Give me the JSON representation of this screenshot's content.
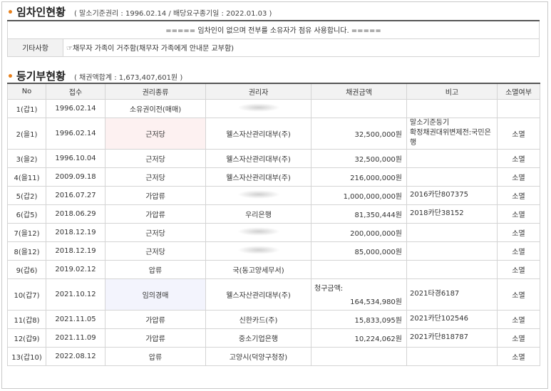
{
  "tenant_section": {
    "title": "임차인현황",
    "subtitle": "( 말소기준권리 : 1996.02.14 / 배당요구종기일 : 2022.01.03 )",
    "notice": "===== 임차인이 없으며 전부를 소유자가 점유 사용합니다. =====",
    "etc_label": "기타사항",
    "etc_value": "☞채무자 가족이 거주함(채무자 가족에게 안내문 교부함)"
  },
  "registry_section": {
    "title": "등기부현황",
    "subtitle": "( 채권액합계 : 1,673,407,601원 )",
    "headers": [
      "No",
      "접수",
      "권리종류",
      "권리자",
      "채권금액",
      "비고",
      "소멸여부"
    ],
    "rows": [
      {
        "no": "1(갑1)",
        "date": "1996.02.14",
        "type": "소유권이전(매매)",
        "holder": "",
        "holder_hidden": true,
        "amount": "",
        "memo": "",
        "status": ""
      },
      {
        "no": "2(을1)",
        "date": "1996.02.14",
        "type": "근저당",
        "holder": "웰스자산관리대부(주)",
        "amount": "32,500,000원",
        "memo": "말소기준등기\n확정채권대위변제전:국민은행",
        "status": "소멸"
      },
      {
        "no": "3(을2)",
        "date": "1996.10.04",
        "type": "근저당",
        "holder": "웰스자산관리대부(주)",
        "amount": "32,500,000원",
        "memo": "",
        "status": "소멸"
      },
      {
        "no": "4(을11)",
        "date": "2009.09.18",
        "type": "근저당",
        "holder": "웰스자산관리대부(주)",
        "amount": "216,000,000원",
        "memo": "",
        "status": "소멸"
      },
      {
        "no": "5(갑2)",
        "date": "2016.07.27",
        "type": "가압류",
        "holder": "",
        "holder_hidden": true,
        "amount": "1,000,000,000원",
        "memo": "2016카단807375",
        "status": "소멸"
      },
      {
        "no": "6(갑5)",
        "date": "2018.06.29",
        "type": "가압류",
        "holder": "우리은행",
        "amount": "81,350,444원",
        "memo": "2018카단38152",
        "status": "소멸"
      },
      {
        "no": "7(을12)",
        "date": "2018.12.19",
        "type": "근저당",
        "holder": "",
        "holder_hidden": true,
        "amount": "200,000,000원",
        "memo": "",
        "status": "소멸"
      },
      {
        "no": "8(을12)",
        "date": "2018.12.19",
        "type": "근저당",
        "holder": "",
        "holder_hidden": true,
        "amount": "85,000,000원",
        "memo": "",
        "status": "소멸"
      },
      {
        "no": "9(갑6)",
        "date": "2019.02.12",
        "type": "압류",
        "holder": "국(동고양세무서)",
        "amount": "",
        "memo": "",
        "status": "소멸"
      },
      {
        "no": "10(갑7)",
        "date": "2021.10.12",
        "type": "임의경매",
        "holder": "웰스자산관리대부(주)",
        "amount_label": "청구금액:",
        "amount": "164,534,980원",
        "memo": "2021타경6187",
        "status": "소멸"
      },
      {
        "no": "11(갑8)",
        "date": "2021.11.05",
        "type": "가압류",
        "holder": "신한카드(주)",
        "amount": "15,833,095원",
        "memo": "2021카단102546",
        "status": "소멸"
      },
      {
        "no": "12(갑9)",
        "date": "2021.11.09",
        "type": "가압류",
        "holder": "중소기업은행",
        "amount": "10,224,062원",
        "memo": "2021카단818787",
        "status": "소멸"
      },
      {
        "no": "13(갑10)",
        "date": "2022.08.12",
        "type": "압류",
        "holder": "고양시(덕양구청장)",
        "amount": "",
        "memo": "",
        "status": "소멸"
      }
    ]
  },
  "colors": {
    "bullet": "#e8801c",
    "header_bg": "#f2f2f2",
    "highlight_pink": "#fdf1f1",
    "highlight_blue": "#f3f4fd"
  }
}
